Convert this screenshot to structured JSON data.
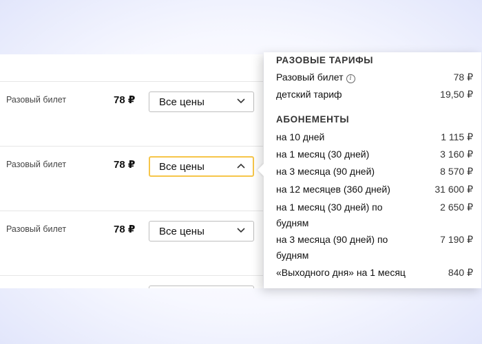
{
  "rows": [
    {
      "label": "Разовый билет",
      "price": "78 ₽",
      "select": "Все цены"
    },
    {
      "label": "Разовый билет",
      "price": "78 ₽",
      "select": "Все цены"
    },
    {
      "label": "Разовый билет",
      "price": "78 ₽",
      "select": "Все цены"
    }
  ],
  "popup": {
    "section1_title": "РАЗОВЫЕ ТАРИФЫ",
    "section1_items": [
      {
        "name": "Разовый билет",
        "price": "78 ₽",
        "info_icon": "info-icon"
      },
      {
        "name": "детский тариф",
        "price": "19,50 ₽"
      }
    ],
    "section2_title": "АБОНЕМЕНТЫ",
    "section2_items": [
      {
        "name": "на 10 дней",
        "price": "1 115 ₽"
      },
      {
        "name": "на 1 месяц (30 дней)",
        "price": "3 160 ₽"
      },
      {
        "name": "на 3 месяца (90 дней)",
        "price": "8 570 ₽"
      },
      {
        "name": "на 12 месяцев (360 дней)",
        "price": "31 600 ₽"
      },
      {
        "name": "на 1 месяц (30 дней) по будням",
        "price": "2 650 ₽"
      },
      {
        "name": "на 3 месяца (90 дней) по будням",
        "price": "7 190 ₽"
      },
      {
        "name": "«Выходного дня» на 1 месяц",
        "price": "840 ₽"
      }
    ]
  },
  "colors": {
    "focus_border": "#f6c548"
  }
}
